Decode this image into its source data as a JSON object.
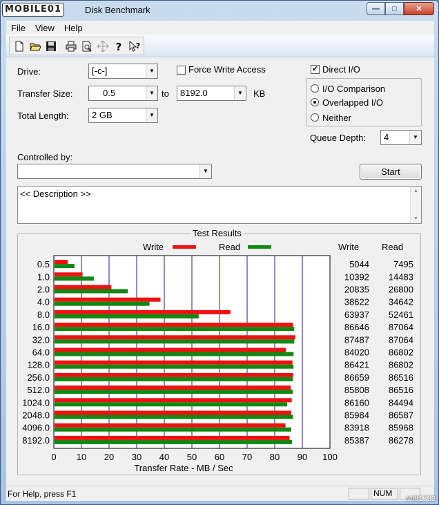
{
  "window": {
    "title": "Disk Benchmark",
    "logo": "MOBILE01",
    "controls": {
      "minimize": "—",
      "maximize": "□",
      "close": "✕"
    }
  },
  "menu": [
    "File",
    "View",
    "Help"
  ],
  "toolbar_icons": [
    "new-icon",
    "open-icon",
    "save-icon",
    "print-icon",
    "print-preview-icon",
    "move-icon",
    "help-icon",
    "context-help-icon"
  ],
  "form": {
    "drive_label": "Drive:",
    "drive_value": "[-c-]",
    "force_write_label": "Force Write Access",
    "force_write_checked": false,
    "direct_io_label": "Direct I/O",
    "direct_io_checked": true,
    "transfer_size_label": "Transfer Size:",
    "transfer_from": "0.5",
    "to_label": "to",
    "transfer_to": "8192.0",
    "kb_label": "KB",
    "total_length_label": "Total Length:",
    "total_length_value": "2 GB",
    "io_mode_options": [
      "I/O Comparison",
      "Overlapped I/O",
      "Neither"
    ],
    "io_mode_selected": "Overlapped I/O",
    "queue_depth_label": "Queue Depth:",
    "queue_depth_value": "4",
    "controlled_by_label": "Controlled by:",
    "controlled_by_value": "",
    "start_label": "Start",
    "description": "<< Description >>"
  },
  "results": {
    "group_title": "Test Results",
    "col_write": "Write",
    "col_read": "Read",
    "colors": {
      "write": "#ee1111",
      "read": "#118811"
    }
  },
  "chart_data": {
    "type": "bar",
    "orientation": "horizontal",
    "categories": [
      "0.5",
      "1.0",
      "2.0",
      "4.0",
      "8.0",
      "16.0",
      "32.0",
      "64.0",
      "128.0",
      "256.0",
      "512.0",
      "1024.0",
      "2048.0",
      "4096.0",
      "8192.0"
    ],
    "series": [
      {
        "name": "Write",
        "values": [
          5044,
          10392,
          20835,
          38622,
          63937,
          86646,
          87487,
          84020,
          86421,
          86659,
          85808,
          86160,
          85984,
          83918,
          85387
        ]
      },
      {
        "name": "Read",
        "values": [
          7495,
          14483,
          26800,
          34642,
          52461,
          87064,
          87064,
          86802,
          86802,
          86516,
          86516,
          84494,
          86587,
          85968,
          86278
        ]
      }
    ],
    "value_unit": "KB/s",
    "xlabel": "Transfer Rate - MB / Sec",
    "xlim": [
      0,
      100
    ],
    "xticks": [
      0,
      10,
      20,
      30,
      40,
      50,
      60,
      70,
      80,
      90,
      100
    ],
    "grid": true,
    "legend_placement": "top"
  },
  "status": {
    "help_text": "For Help, press F1",
    "num": "NUM",
    "watermark": "#491733"
  }
}
